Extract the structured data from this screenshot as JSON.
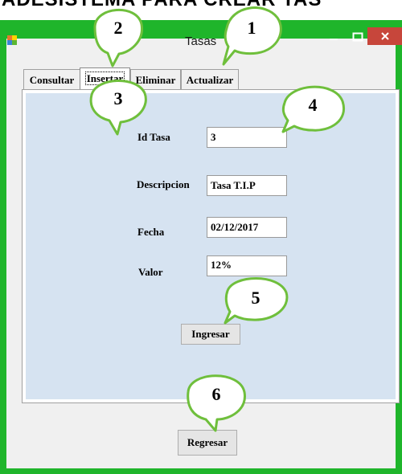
{
  "banner": {
    "text": "ADESISTEMA PARA CREAR TAS"
  },
  "window": {
    "title": "Tasas",
    "accent": "#1fb52b",
    "close_color": "#c7463b"
  },
  "tabs": [
    {
      "label": "Consultar"
    },
    {
      "label": "Insertar"
    },
    {
      "label": "Eliminar"
    },
    {
      "label": "Actualizar"
    }
  ],
  "form": {
    "id_label": "Id Tasa",
    "id_value": "3",
    "desc_label": "Descripcion",
    "desc_value": "Tasa T.I.P",
    "date_label": "Fecha",
    "date_value": "02/12/2017",
    "value_label": "Valor",
    "value_value": "12%",
    "submit_label": "Ingresar"
  },
  "back_label": "Regresar",
  "callouts": [
    "1",
    "2",
    "3",
    "4",
    "5",
    "6"
  ],
  "icons": {
    "app": "windows-app-icon",
    "min": "minimize-icon",
    "max": "maximize-icon",
    "close": "close-icon"
  }
}
